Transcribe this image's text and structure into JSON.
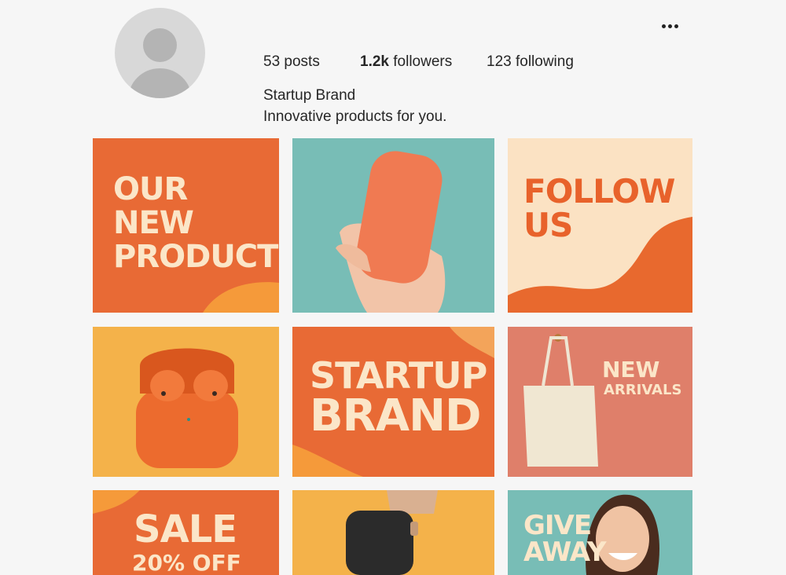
{
  "profile": {
    "posts_count": "53",
    "posts_label": "posts",
    "followers_count": "1.2k",
    "followers_label": "followers",
    "following_count": "123",
    "following_label": "following",
    "name": "Startup Brand",
    "bio": "Innovative products for you."
  },
  "grid": {
    "post1": "OUR\nNEW\nPRODUCT",
    "post3": "FOLLOW\nUS",
    "post5_line1": "STARTUP",
    "post5_line2": "BRAND",
    "post6_line1": "NEW",
    "post6_line2": "ARRIVALS",
    "post7_line1": "SALE",
    "post7_line2": "20% OFF",
    "post9": "GIVE\nAWAY"
  },
  "icons": {
    "avatar": "default-user-avatar",
    "more": "more-options-icon"
  },
  "colors": {
    "orange": "#e86a35",
    "teal": "#78bdb6",
    "cream": "#fbe2c3",
    "yellow": "#f4b24a",
    "salmon": "#df7f6a"
  }
}
